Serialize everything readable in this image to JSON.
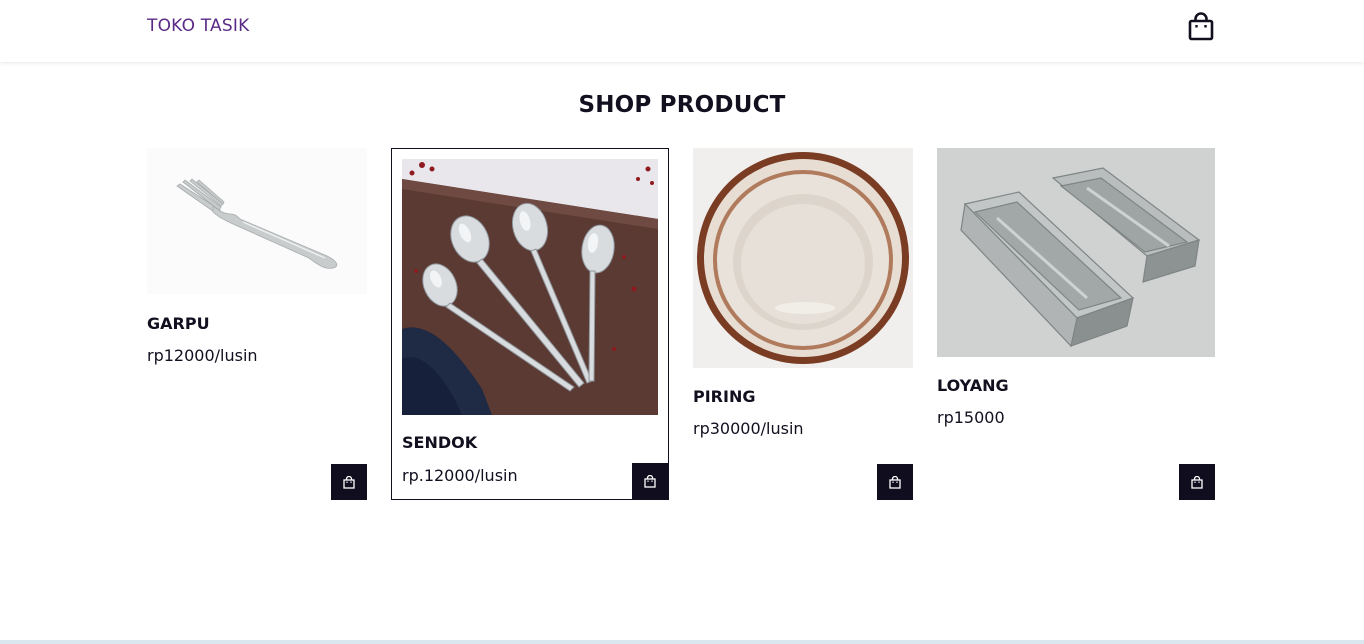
{
  "navbar": {
    "brand": "TOKO TASIK",
    "cart_icon": "shopping-bag-icon"
  },
  "page": {
    "title": "SHOP PRODUCT"
  },
  "products": [
    {
      "name": "GARPU",
      "price": "rp12000/lusin",
      "image": "fork-image",
      "button_icon": "shopping-bag-icon"
    },
    {
      "name": "SENDOK",
      "price": "rp.12000/lusin",
      "image": "spoons-image",
      "button_icon": "shopping-bag-icon"
    },
    {
      "name": "PIRING",
      "price": "rp30000/lusin",
      "image": "plate-image",
      "button_icon": "shopping-bag-icon"
    },
    {
      "name": "LOYANG",
      "price": "rp15000",
      "image": "baking-pan-image",
      "button_icon": "shopping-bag-icon"
    }
  ],
  "colors": {
    "brand": "#5b2a86",
    "text": "#12101f",
    "button_bg": "#0f0d1e"
  }
}
